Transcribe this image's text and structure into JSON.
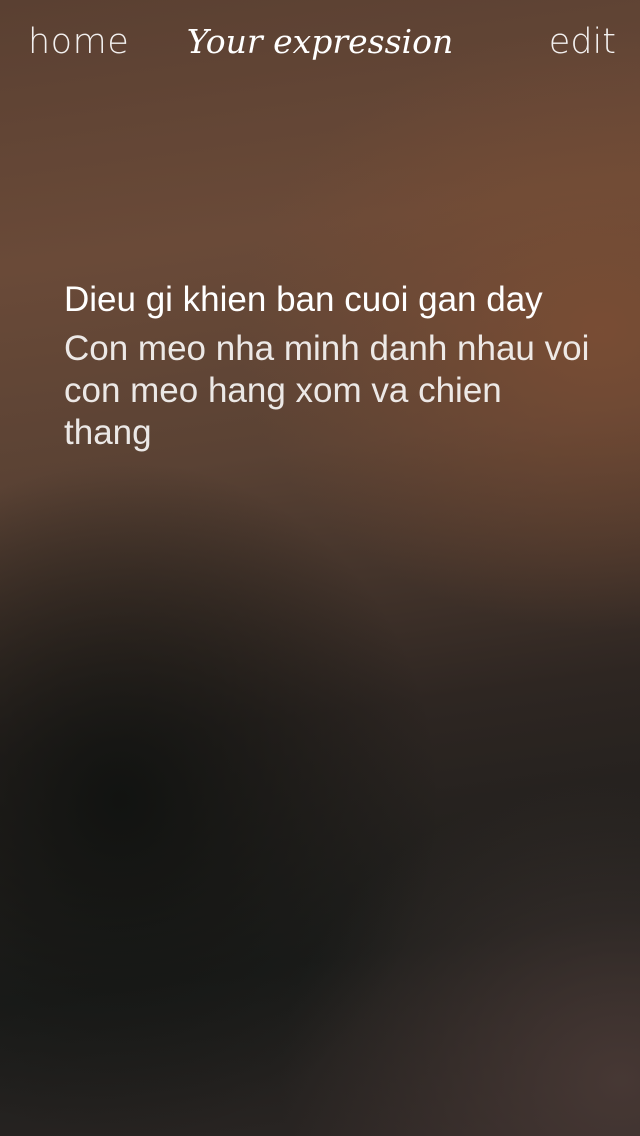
{
  "nav": {
    "home_label": "home",
    "title": "Your expression",
    "edit_label": "edit"
  },
  "expression": {
    "question": "Dieu gi khien ban cuoi gan day",
    "answer": "Con meo nha minh danh nhau voi con meo hang xom va chien thang"
  }
}
